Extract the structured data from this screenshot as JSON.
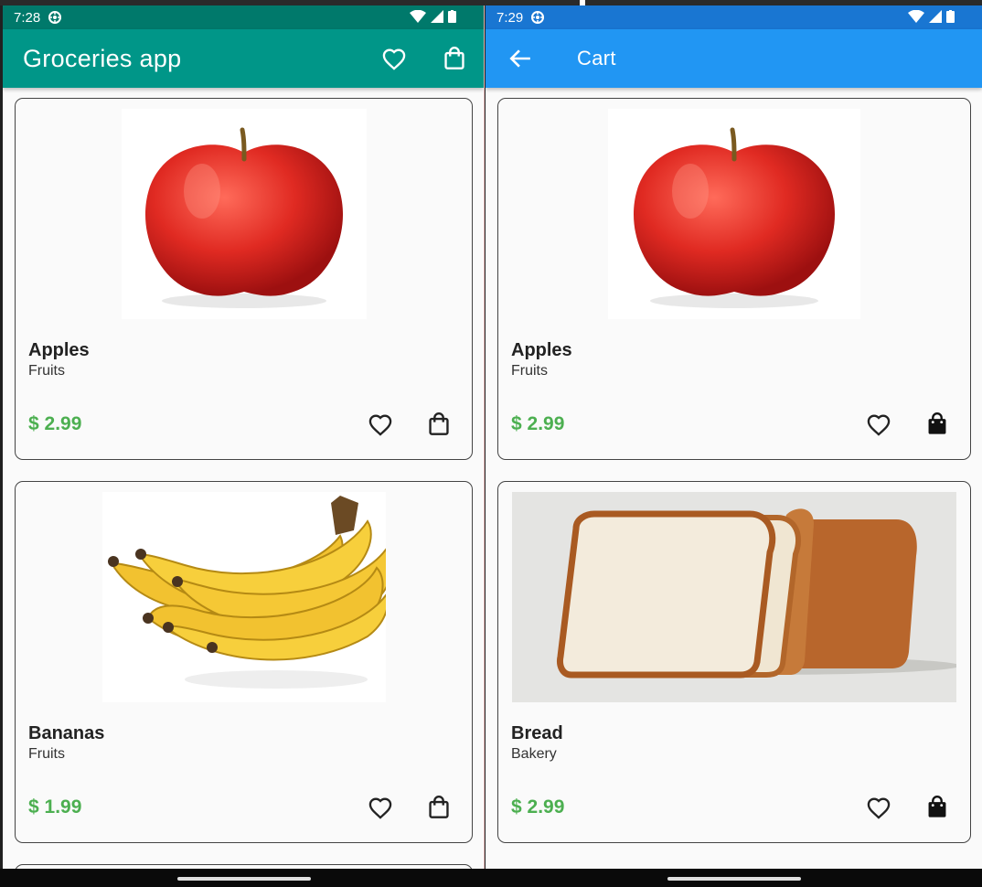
{
  "left_screen": {
    "status": {
      "time": "7:28"
    },
    "appbar": {
      "title": "Groceries app",
      "actions": [
        "heart-outline-icon",
        "shopping-bag-outline-icon"
      ]
    },
    "products": [
      {
        "name": "Apples",
        "category": "Fruits",
        "price": "$ 2.99",
        "favorite": false,
        "in_cart": false,
        "image": "apple"
      },
      {
        "name": "Bananas",
        "category": "Fruits",
        "price": "$ 1.99",
        "favorite": false,
        "in_cart": false,
        "image": "bananas"
      }
    ]
  },
  "right_screen": {
    "status": {
      "time": "7:29"
    },
    "appbar": {
      "title": "Cart",
      "back": "arrow-back-icon"
    },
    "products": [
      {
        "name": "Apples",
        "category": "Fruits",
        "price": "$ 2.99",
        "favorite": false,
        "in_cart": true,
        "image": "apple"
      },
      {
        "name": "Bread",
        "category": "Bakery",
        "price": "$ 2.99",
        "favorite": false,
        "in_cart": true,
        "image": "bread"
      }
    ]
  },
  "colors": {
    "teal_dark": "#00796b",
    "teal": "#009688",
    "blue_dark": "#1976d2",
    "blue": "#2196f3",
    "price_green": "#4caf50"
  }
}
